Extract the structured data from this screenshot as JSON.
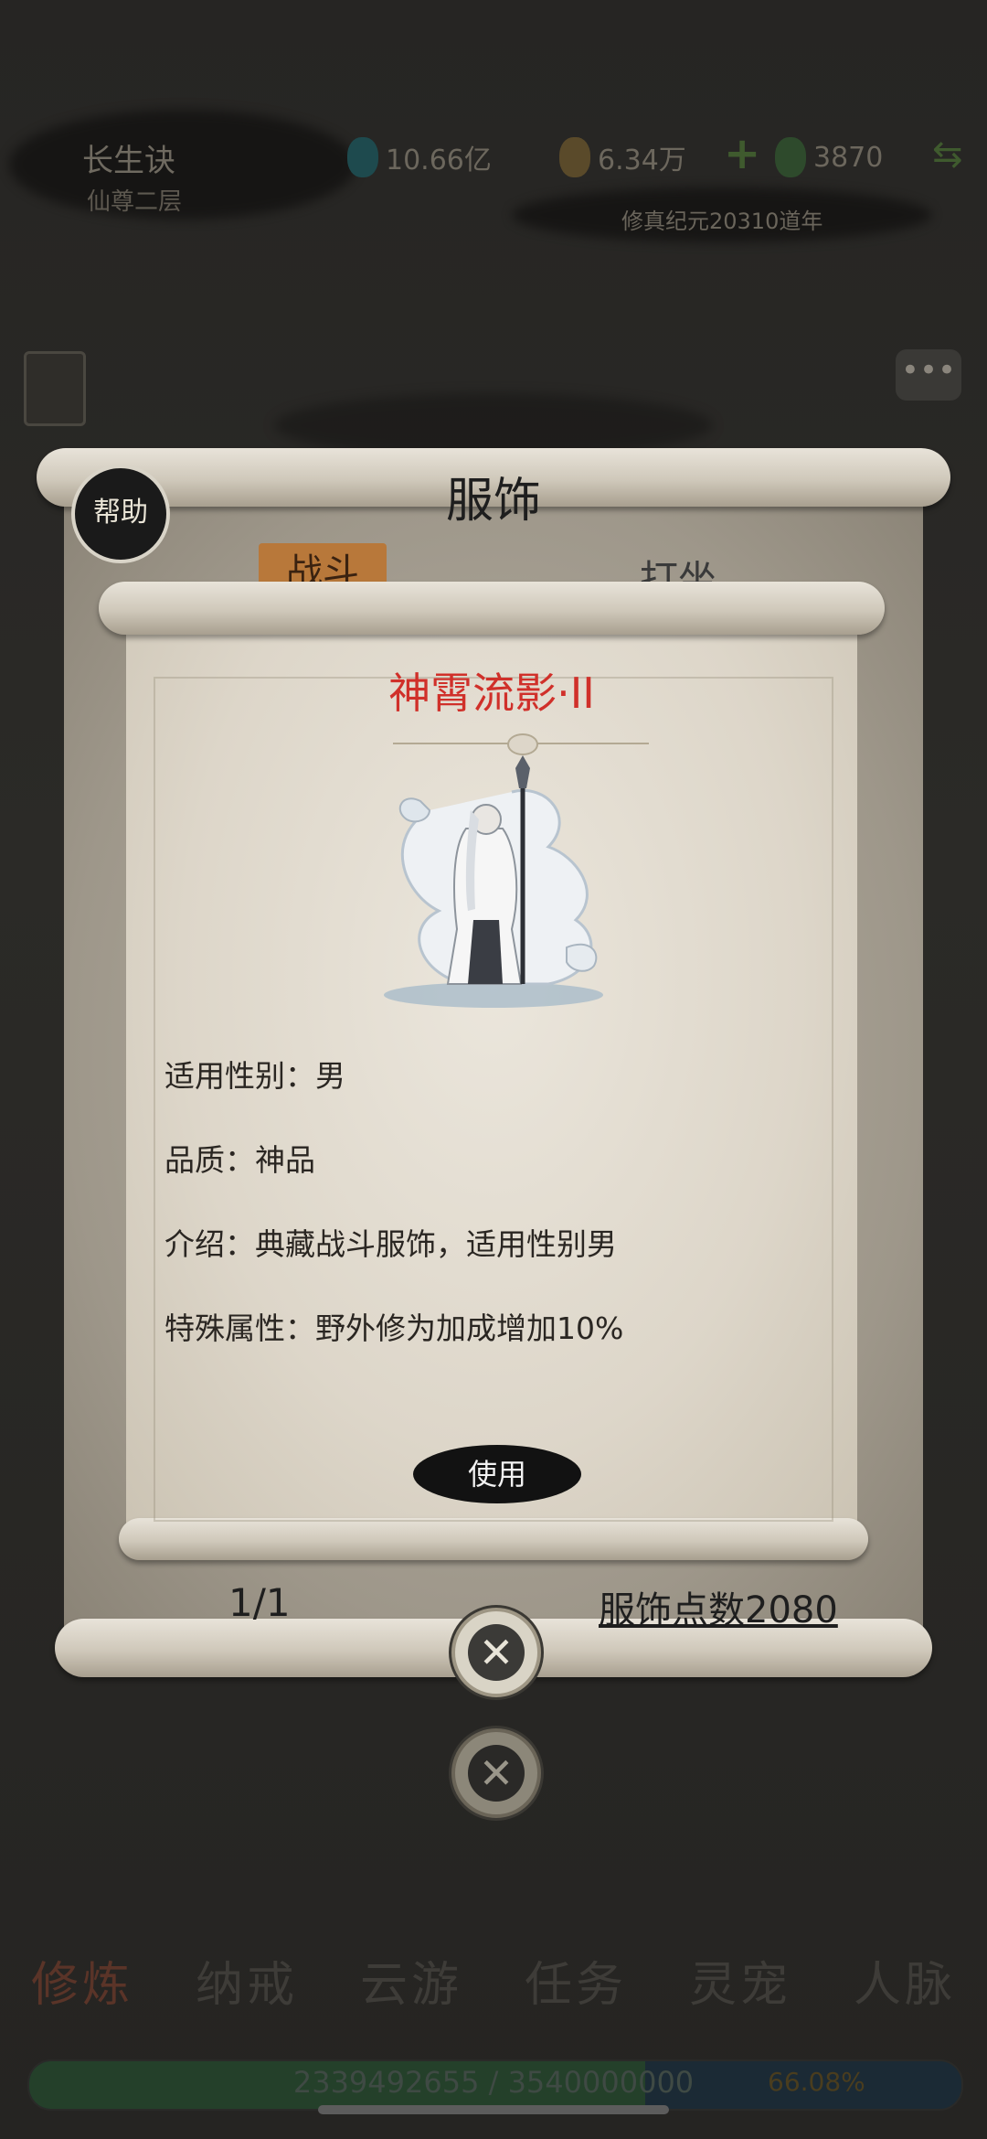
{
  "header": {
    "game_title": "长生诀",
    "realm": "仙尊二层",
    "spirit_stones": "10.66亿",
    "gold": "6.34万",
    "plus_label": "+",
    "jade": "3870",
    "era": "修真纪元20310道年"
  },
  "modal": {
    "title": "服饰",
    "help_label": "帮助",
    "tab_left": "战斗",
    "tab_right": "打坐",
    "page_indicator": "1/1",
    "points": "服饰点数2080"
  },
  "item": {
    "name": "神霄流影·II",
    "gender": "适用性别：男",
    "quality": "品质：神品",
    "intro": "介绍：典藏战斗服饰，适用性别男",
    "special": "特殊属性：野外修为加成增加10%",
    "use_label": "使用"
  },
  "bottom_nav": [
    "修炼",
    "纳戒",
    "云游",
    "任务",
    "灵宠",
    "人脉"
  ],
  "xp": {
    "text": "2339492655 / 3540000000",
    "percent_label": "66.08%",
    "fraction": 0.6608
  },
  "icons": {
    "close": "close-icon",
    "chat": "chat-bubble-icon",
    "swap": "swap-arrows-icon"
  },
  "colors": {
    "item_name": "#d0302a",
    "tab_active": "#b8783a"
  }
}
